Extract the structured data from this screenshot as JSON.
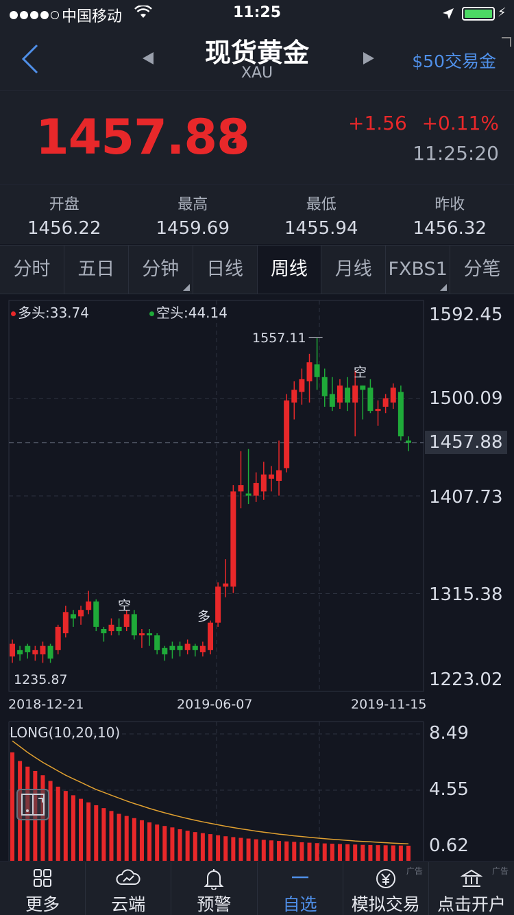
{
  "status_bar": {
    "carrier": "中国移动",
    "time": "11:25"
  },
  "nav": {
    "title": "现货黄金",
    "subtitle": "XAU",
    "trade_link": "$50交易金"
  },
  "quote": {
    "price": "1457.88",
    "change": "+1.56",
    "change_pct": "+0.11%",
    "time": "11:25:20",
    "up_color": "#e8282a"
  },
  "ohlc": [
    {
      "label": "开盘",
      "value": "1456.22"
    },
    {
      "label": "最高",
      "value": "1459.69"
    },
    {
      "label": "最低",
      "value": "1455.94"
    },
    {
      "label": "昨收",
      "value": "1456.32"
    }
  ],
  "period_tabs": [
    {
      "label": "分时",
      "active": false,
      "menu": false
    },
    {
      "label": "五日",
      "active": false,
      "menu": false
    },
    {
      "label": "分钟",
      "active": false,
      "menu": true
    },
    {
      "label": "日线",
      "active": false,
      "menu": false
    },
    {
      "label": "周线",
      "active": true,
      "menu": false
    },
    {
      "label": "月线",
      "active": false,
      "menu": false
    },
    {
      "label": "FXBS1",
      "active": false,
      "menu": true
    },
    {
      "label": "分笔",
      "active": false,
      "menu": false
    }
  ],
  "legend": {
    "long": "多头:33.74",
    "short": "空头:44.14"
  },
  "chart_data": [
    {
      "type": "candlestick",
      "y_axis_labels": [
        "1592.45",
        "1500.09",
        "1457.88",
        "1407.73",
        "1315.38",
        "1223.02"
      ],
      "x_axis_labels": [
        "2018-12-21",
        "2019-06-07",
        "2019-11-15"
      ],
      "ylim": [
        1223.02,
        1592.45
      ],
      "current_price_line": 1457.88,
      "max_label": "1557.11",
      "min_label": "1235.87",
      "annotations": [
        "空",
        "多",
        "空"
      ],
      "colors": {
        "up": "#e8282a",
        "down": "#1faa39"
      },
      "candles": [
        [
          1256,
          1268,
          1250,
          1272
        ],
        [
          1262,
          1258,
          1252,
          1266
        ],
        [
          1266,
          1260,
          1254,
          1268
        ],
        [
          1258,
          1262,
          1252,
          1266
        ],
        [
          1258,
          1266,
          1250,
          1270
        ],
        [
          1266,
          1254,
          1250,
          1268
        ],
        [
          1262,
          1284,
          1258,
          1286
        ],
        [
          1278,
          1298,
          1274,
          1304
        ],
        [
          1296,
          1292,
          1284,
          1300
        ],
        [
          1294,
          1300,
          1286,
          1304
        ],
        [
          1300,
          1308,
          1296,
          1318
        ],
        [
          1308,
          1284,
          1280,
          1310
        ],
        [
          1282,
          1278,
          1270,
          1284
        ],
        [
          1280,
          1286,
          1276,
          1292
        ],
        [
          1284,
          1280,
          1276,
          1292
        ],
        [
          1284,
          1296,
          1280,
          1300
        ],
        [
          1296,
          1276,
          1272,
          1300
        ],
        [
          1276,
          1278,
          1264,
          1282
        ],
        [
          1278,
          1276,
          1266,
          1282
        ],
        [
          1276,
          1262,
          1258,
          1278
        ],
        [
          1264,
          1258,
          1252,
          1266
        ],
        [
          1266,
          1262,
          1254,
          1270
        ],
        [
          1266,
          1262,
          1256,
          1270
        ],
        [
          1262,
          1268,
          1258,
          1272
        ],
        [
          1266,
          1262,
          1256,
          1268
        ],
        [
          1260,
          1266,
          1256,
          1270
        ],
        [
          1262,
          1288,
          1258,
          1290
        ],
        [
          1288,
          1322,
          1284,
          1326
        ],
        [
          1322,
          1325,
          1312,
          1348
        ],
        [
          1322,
          1412,
          1316,
          1418
        ],
        [
          1412,
          1418,
          1396,
          1450
        ],
        [
          1410,
          1408,
          1400,
          1452
        ],
        [
          1408,
          1420,
          1402,
          1430
        ],
        [
          1412,
          1428,
          1404,
          1440
        ],
        [
          1424,
          1428,
          1412,
          1436
        ],
        [
          1422,
          1432,
          1408,
          1460
        ],
        [
          1434,
          1498,
          1430,
          1504
        ],
        [
          1496,
          1508,
          1480,
          1516
        ],
        [
          1506,
          1518,
          1494,
          1528
        ],
        [
          1516,
          1534,
          1496,
          1542
        ],
        [
          1532,
          1520,
          1508,
          1557.11
        ],
        [
          1520,
          1502,
          1492,
          1528
        ],
        [
          1504,
          1492,
          1488,
          1520
        ],
        [
          1496,
          1512,
          1490,
          1518
        ],
        [
          1510,
          1496,
          1488,
          1520
        ],
        [
          1496,
          1512,
          1464,
          1526
        ],
        [
          1512,
          1508,
          1480,
          1512
        ],
        [
          1510,
          1488,
          1486,
          1518
        ],
        [
          1488,
          1490,
          1474,
          1498
        ],
        [
          1492,
          1500,
          1486,
          1504
        ],
        [
          1496,
          1510,
          1490,
          1514
        ],
        [
          1506,
          1464,
          1460,
          1512
        ],
        [
          1460,
          1457.88,
          1450,
          1464
        ]
      ]
    },
    {
      "type": "bar",
      "name": "LONG(10,20,10)",
      "y_axis_labels": [
        "8.49",
        "4.55",
        "0.62"
      ],
      "ylim": [
        0.62,
        8.49
      ],
      "colors": {
        "bar": "#e8282a",
        "line": "#e0a030"
      },
      "values": [
        7.2,
        6.6,
        6.2,
        5.9,
        5.6,
        5.2,
        4.8,
        4.5,
        4.2,
        3.95,
        3.7,
        3.5,
        3.3,
        3.1,
        2.9,
        2.75,
        2.6,
        2.45,
        2.3,
        2.15,
        2.05,
        1.95,
        1.82,
        1.72,
        1.62,
        1.55,
        1.48,
        1.4,
        1.33,
        1.27,
        1.22,
        1.17,
        1.12,
        1.08,
        1.04,
        1.0,
        0.97,
        0.94,
        0.91,
        0.88,
        0.85,
        0.83,
        0.81,
        0.79,
        0.77,
        0.75,
        0.73,
        0.72,
        0.71,
        0.7,
        0.69,
        0.68,
        0.67
      ],
      "line_values": [
        8.0,
        7.6,
        7.2,
        6.85,
        6.5,
        6.2,
        5.9,
        5.6,
        5.35,
        5.1,
        4.85,
        4.6,
        4.4,
        4.2,
        4.0,
        3.8,
        3.62,
        3.45,
        3.28,
        3.12,
        2.97,
        2.83,
        2.7,
        2.57,
        2.45,
        2.34,
        2.23,
        2.13,
        2.03,
        1.94,
        1.85,
        1.77,
        1.69,
        1.62,
        1.55,
        1.48,
        1.42,
        1.36,
        1.31,
        1.26,
        1.21,
        1.16,
        1.12,
        1.08,
        1.04,
        1.0,
        0.97,
        0.94,
        0.91,
        0.88,
        0.85,
        0.82,
        0.8
      ]
    }
  ],
  "tab_bar": [
    {
      "label": "更多",
      "icon": "grid-icon",
      "active": false,
      "ad": ""
    },
    {
      "label": "云端",
      "icon": "cloud-icon",
      "active": false,
      "ad": ""
    },
    {
      "label": "预警",
      "icon": "bell-icon",
      "active": false,
      "ad": ""
    },
    {
      "label": "自选",
      "icon": "dash-icon",
      "active": true,
      "ad": ""
    },
    {
      "label": "模拟交易",
      "icon": "yen-coin-icon",
      "active": false,
      "ad": "广告"
    },
    {
      "label": "点击开户",
      "icon": "bank-icon",
      "active": false,
      "ad": "广告"
    }
  ]
}
